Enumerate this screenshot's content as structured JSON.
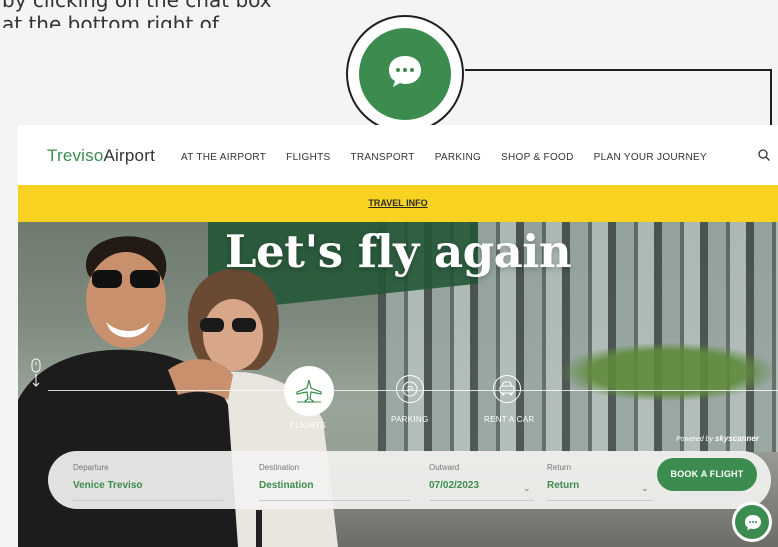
{
  "intro": {
    "text": "by clicking on the chat box at the bottom right of"
  },
  "callout": {
    "icon": "chat-bubble-icon",
    "color": "#3c8c4f"
  },
  "header": {
    "logo_part1": "Treviso",
    "logo_part2": "Airport",
    "nav": [
      {
        "label": "AT THE AIRPORT"
      },
      {
        "label": "FLIGHTS"
      },
      {
        "label": "TRANSPORT"
      },
      {
        "label": "PARKING"
      },
      {
        "label": "SHOP & FOOD"
      },
      {
        "label": "PLAN YOUR JOURNEY"
      }
    ],
    "search_icon": "search-icon"
  },
  "travel_bar": {
    "label": "TRAVEL INFO",
    "color": "#f7d221"
  },
  "hero": {
    "title": "Let's fly again",
    "tabs": [
      {
        "label": "FLIGHTS",
        "icon": "plane-icon",
        "active": true
      },
      {
        "label": "PARKING",
        "icon": "parking-icon",
        "active": false
      },
      {
        "label": "RENT A CAR",
        "icon": "car-icon",
        "active": false
      }
    ],
    "powered_prefix": "Powered by",
    "powered_brand": "skyscanner"
  },
  "booking": {
    "departure": {
      "label": "Departure",
      "value": "Venice Treviso"
    },
    "destination": {
      "label": "Destination",
      "value": "Destination"
    },
    "outward": {
      "label": "Outward",
      "value": "07/02/2023"
    },
    "return": {
      "label": "Return",
      "value": "Return"
    },
    "button": "BOOK A FLIGHT",
    "accent": "#3c8c4f"
  }
}
